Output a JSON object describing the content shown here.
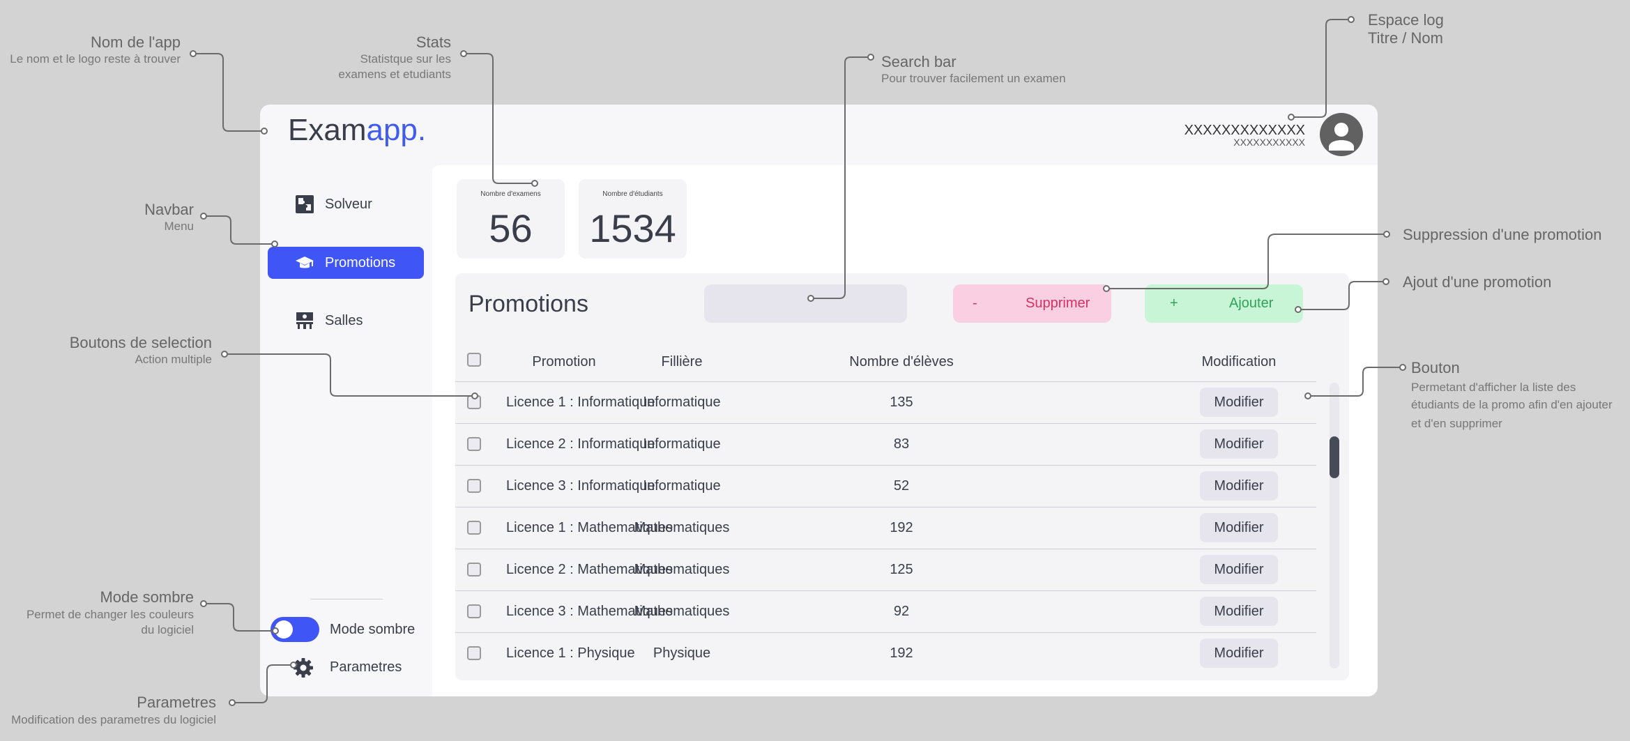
{
  "app": {
    "logo_part1": "Exam",
    "logo_part2": "app.",
    "user_name": "XXXXXXXXXXXXX",
    "user_sub": "XXXXXXXXXXX"
  },
  "sidebar": {
    "items": [
      {
        "label": "Solveur",
        "icon": "puzzle-icon"
      },
      {
        "label": "Promotions",
        "icon": "graduation-cap-icon",
        "active": true
      },
      {
        "label": "Salles",
        "icon": "classroom-icon"
      }
    ],
    "dark_mode_label": "Mode sombre",
    "settings_label": "Parametres"
  },
  "stats": [
    {
      "label": "Nombre d'examens",
      "value": "56"
    },
    {
      "label": "Nombre d'étudiants",
      "value": "1534"
    }
  ],
  "panel": {
    "title": "Promotions",
    "search_placeholder": "",
    "delete_symbol": "-",
    "delete_label": "Supprimer",
    "add_symbol": "+",
    "add_label": "Ajouter",
    "columns": [
      "Promotion",
      "Fillière",
      "Nombre d'élèves",
      "Modification"
    ],
    "rows": [
      {
        "promotion": "Licence 1 : Informatique",
        "filiere": "Informatique",
        "count": "135",
        "action": "Modifier"
      },
      {
        "promotion": "Licence 2 : Informatique",
        "filiere": "Informatique",
        "count": "83",
        "action": "Modifier"
      },
      {
        "promotion": "Licence 3 : Informatique",
        "filiere": "Informatique",
        "count": "52",
        "action": "Modifier"
      },
      {
        "promotion": "Licence 1 : Mathematiques",
        "filiere": "Mathematiques",
        "count": "192",
        "action": "Modifier"
      },
      {
        "promotion": "Licence 2 : Mathematiques",
        "filiere": "Mathematiques",
        "count": "125",
        "action": "Modifier"
      },
      {
        "promotion": "Licence 3 : Mathematiques",
        "filiere": "Mathematiques",
        "count": "92",
        "action": "Modifier"
      },
      {
        "promotion": "Licence 1 : Physique",
        "filiere": "Physique",
        "count": "192",
        "action": "Modifier"
      }
    ]
  },
  "annotations": {
    "app_name": {
      "title": "Nom de l'app",
      "desc": "Le nom et le logo reste à trouver"
    },
    "stats": {
      "title": "Stats",
      "desc1": "Statistque sur les",
      "desc2": "examens et etudiants"
    },
    "search": {
      "title": "Search bar",
      "desc": "Pour trouver facilement un examen"
    },
    "log": {
      "title1": "Espace log",
      "title2": "Titre / Nom"
    },
    "navbar": {
      "title": "Navbar",
      "desc": "Menu"
    },
    "delete": {
      "title": "Suppression d'une promotion"
    },
    "add": {
      "title": "Ajout d'une promotion"
    },
    "selection": {
      "title": "Boutons de selection",
      "desc": "Action multiple"
    },
    "button": {
      "title": "Bouton",
      "desc1": "Permetant d'afficher la liste des",
      "desc2": "étudiants de la promo afin d'en ajouter",
      "desc3": "et d'en supprimer"
    },
    "dark_mode": {
      "title": "Mode sombre",
      "desc1": "Permet de changer les couleurs",
      "desc2": "du logiciel"
    },
    "settings": {
      "title": "Parametres",
      "desc": "Modification des parametres du logiciel"
    }
  },
  "colors": {
    "accent": "#3f55f5",
    "logo_accent": "#3f5bf0",
    "delete": "#d4325f",
    "add": "#2fa35a"
  }
}
